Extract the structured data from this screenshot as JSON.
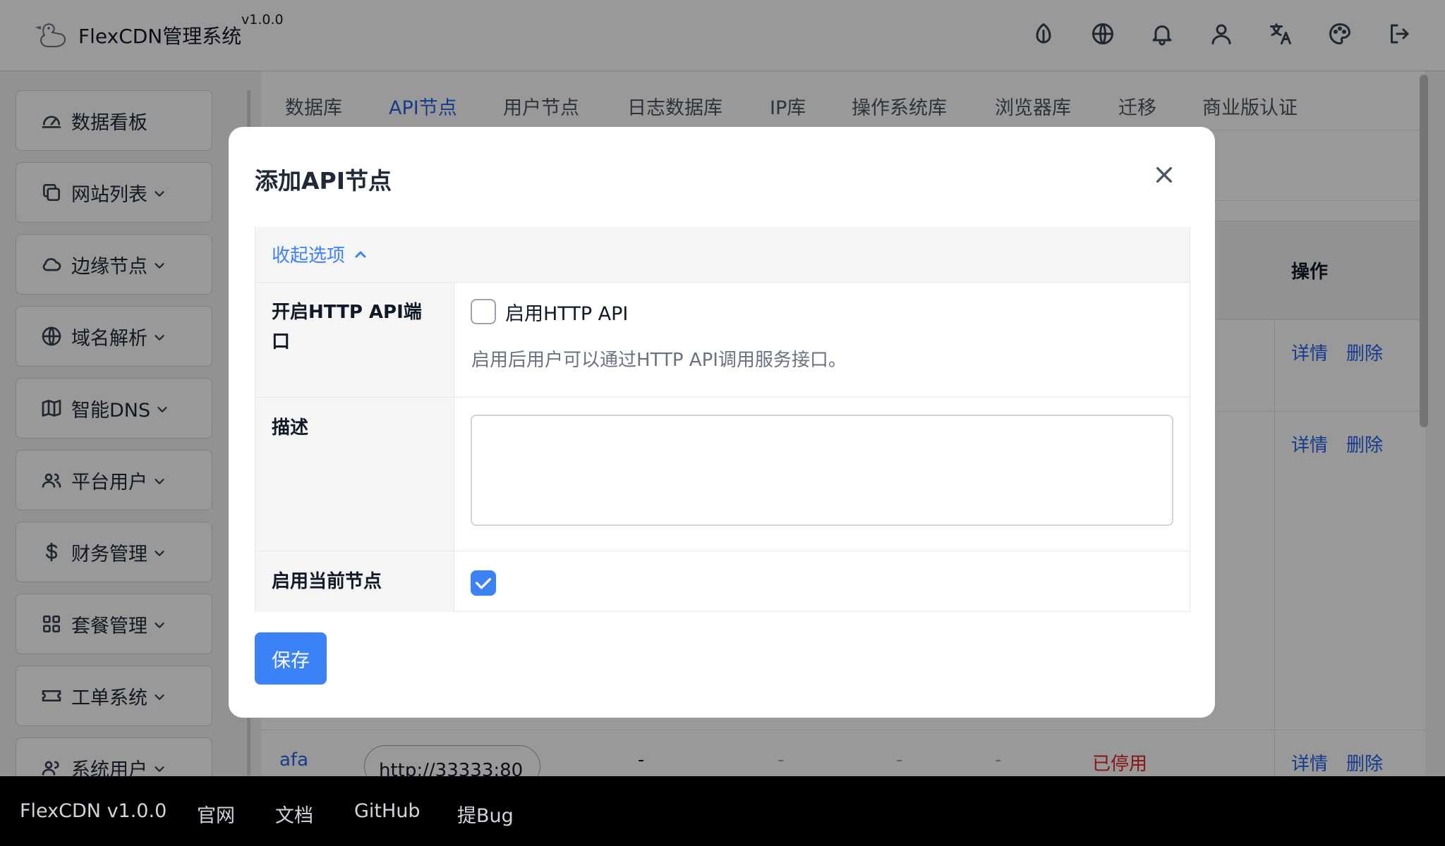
{
  "header": {
    "title": "FlexCDN管理系统",
    "version": "v1.0.0",
    "icons": [
      "leaf-icon",
      "globe-icon",
      "bell-icon",
      "user-icon",
      "translate-icon",
      "palette-icon",
      "logout-icon"
    ]
  },
  "sidebar": {
    "items": [
      {
        "label": "数据看板",
        "icon": "dashboard-icon",
        "expandable": false
      },
      {
        "label": "网站列表",
        "icon": "copy-icon",
        "expandable": true
      },
      {
        "label": "边缘节点",
        "icon": "cloud-icon",
        "expandable": true
      },
      {
        "label": "域名解析",
        "icon": "globe-icon",
        "expandable": true
      },
      {
        "label": "智能DNS",
        "icon": "map-icon",
        "expandable": true
      },
      {
        "label": "平台用户",
        "icon": "users-icon",
        "expandable": true
      },
      {
        "label": "财务管理",
        "icon": "dollar-icon",
        "expandable": true
      },
      {
        "label": "套餐管理",
        "icon": "grid-icon",
        "expandable": true
      },
      {
        "label": "工单系统",
        "icon": "ticket-icon",
        "expandable": true
      },
      {
        "label": "系统用户",
        "icon": "users-icon",
        "expandable": true
      }
    ]
  },
  "tabs": [
    "数据库",
    "API节点",
    "用户节点",
    "日志数据库",
    "IP库",
    "操作系统库",
    "浏览器库",
    "迁移",
    "商业版认证"
  ],
  "active_tab": "API节点",
  "table": {
    "op_header": "操作",
    "detail_label": "详情",
    "delete_label": "删除",
    "last_row": {
      "name": "afa",
      "url": "http://33333:80",
      "col3": "-",
      "col4": "-",
      "col5": "-",
      "col6": "-",
      "status": "已停用"
    }
  },
  "modal": {
    "title": "添加API节点",
    "collapse_label": "收起选项",
    "http_api_label": "开启HTTP API端口",
    "http_api_checkbox_label": "启用HTTP API",
    "http_api_checked": false,
    "http_api_help": "启用后用户可以通过HTTP API调用服务接口。",
    "desc_label": "描述",
    "desc_value": "",
    "enable_label": "启用当前节点",
    "enable_checked": true,
    "save_label": "保存"
  },
  "footer": {
    "links": [
      "FlexCDN v1.0.0",
      "官网",
      "文档",
      "GitHub",
      "提Bug"
    ]
  },
  "colors": {
    "accent": "#3b82f6",
    "danger": "#dc2626",
    "footer_bg": "#000000"
  }
}
